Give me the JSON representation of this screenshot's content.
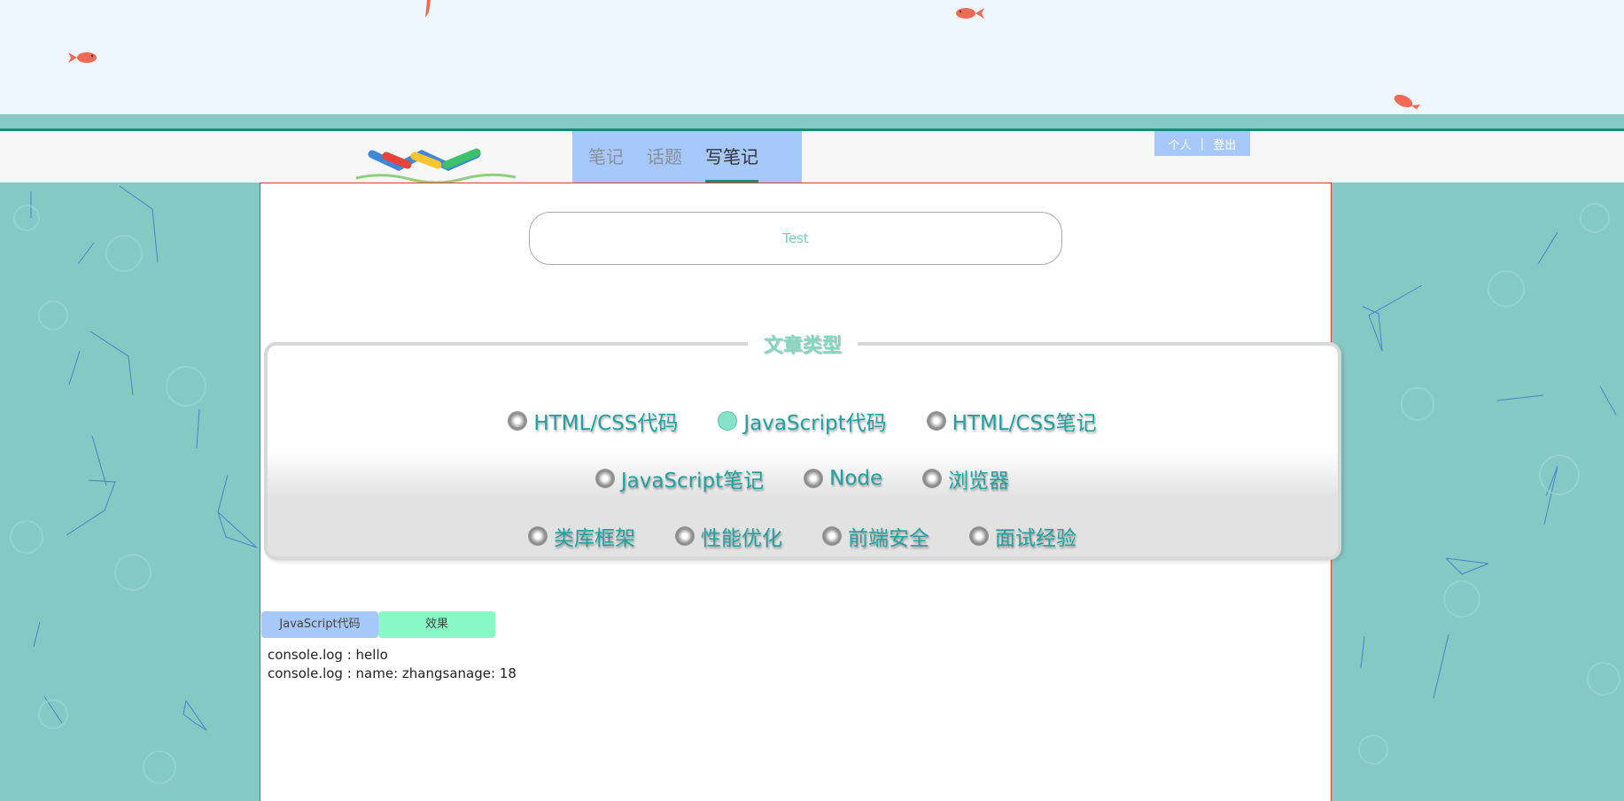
{
  "nav": {
    "tabs": [
      {
        "label": "笔记"
      },
      {
        "label": "话题"
      },
      {
        "label": "写笔记"
      }
    ],
    "user": {
      "profile": "个人",
      "separator": "|",
      "logout": "登出"
    }
  },
  "editor": {
    "title_value": "Test",
    "types_legend": "文章类型",
    "types": [
      {
        "label": "HTML/CSS代码",
        "checked": false
      },
      {
        "label": "JavaScript代码",
        "checked": true
      },
      {
        "label": "HTML/CSS笔记",
        "checked": false
      },
      {
        "label": "JavaScript笔记",
        "checked": false
      },
      {
        "label": "Node",
        "checked": false
      },
      {
        "label": "浏览器",
        "checked": false
      },
      {
        "label": "类库框架",
        "checked": false
      },
      {
        "label": "性能优化",
        "checked": false
      },
      {
        "label": "前端安全",
        "checked": false
      },
      {
        "label": "面试经验",
        "checked": false
      }
    ],
    "code_tab": "JavaScript代码",
    "effect_tab": "效果",
    "console_lines": [
      "console.log : hello",
      "console.log : name: zhangsanage: 18"
    ]
  },
  "colors": {
    "accent": "#1c8a78",
    "nav_bg": "#a6c8fa",
    "page_bg": "#84c9c4",
    "effect_bg": "#88f8c4"
  }
}
